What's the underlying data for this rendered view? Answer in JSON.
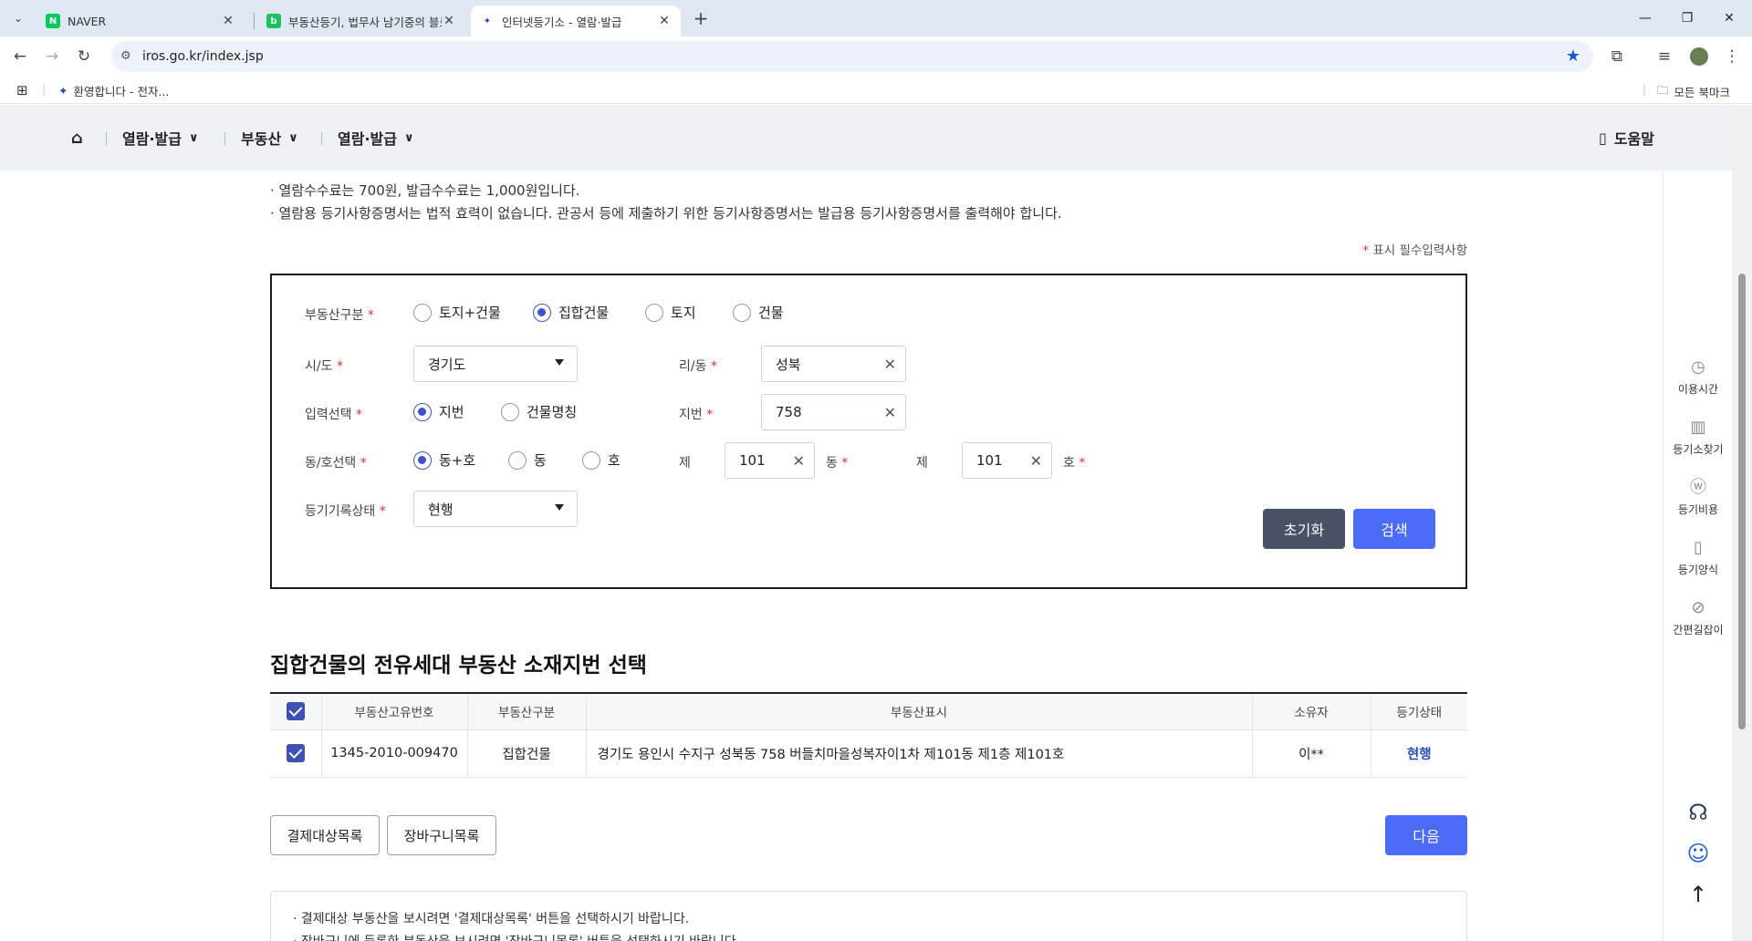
{
  "browser": {
    "tabs": [
      {
        "title": "NAVER",
        "favicon": "naver-favicon"
      },
      {
        "title": "부동산등기, 법무사 남기중의 블로그",
        "favicon": "blog-favicon"
      },
      {
        "title": "인터넷등기소 - 열람·발급",
        "favicon": "iros-favicon"
      }
    ],
    "new_tab": "+",
    "url": "iros.go.kr/index.jsp",
    "bookmark_item": "환영합니다 - 전자...",
    "all_bookmarks": "모든 북마크"
  },
  "site_nav": {
    "items": [
      "열람·발급",
      "부동산",
      "열람·발급"
    ],
    "help": "도움말"
  },
  "notices": [
    "· 열람수수료는 700원, 발급수수료는 1,000원입니다.",
    "· 열람용 등기사항증명서는 법적 효력이 없습니다. 관공서 등에 제출하기 위한 등기사항증명서는 발급용 등기사항증명서를 출력해야 합니다."
  ],
  "required_note": {
    "star": "*",
    "text": "표시 필수입력사항"
  },
  "form": {
    "property_type": {
      "label": "부동산구분",
      "options": [
        "토지+건물",
        "집합건물",
        "토지",
        "건물"
      ],
      "selected": "집합건물"
    },
    "sido": {
      "label": "시/도",
      "value": "경기도"
    },
    "ri_dong": {
      "label": "리/동",
      "value": "성북"
    },
    "input_select": {
      "label": "입력선택",
      "options": [
        "지번",
        "건물명칭"
      ],
      "selected": "지번"
    },
    "jibun": {
      "label": "지번",
      "value": "758"
    },
    "dong_ho_select": {
      "label": "동/호선택",
      "options": [
        "동+호",
        "동",
        "호"
      ],
      "selected": "동+호"
    },
    "dong": {
      "prefix": "제",
      "value": "101",
      "suffix": "동"
    },
    "ho": {
      "prefix": "제",
      "value": "101",
      "suffix": "호"
    },
    "record_status": {
      "label": "등기기록상태",
      "value": "현행"
    },
    "reset_button": "초기화",
    "search_button": "검색"
  },
  "section_title": "집합건물의 전유세대 부동산 소재지번 선택",
  "table": {
    "headers": [
      "부동산고유번호",
      "부동산구분",
      "부동산표시",
      "소유자",
      "등기상태"
    ],
    "rows": [
      {
        "id": "1345-2010-009470",
        "type": "집합건물",
        "address": "경기도 용인시 수지구 성북동 758 버들치마을성복자이1차 제101동 제1층 제101호",
        "owner": "이**",
        "status": "현행",
        "checked": true
      }
    ],
    "header_checked": true
  },
  "actions": {
    "payment_list": "결제대상목록",
    "cart_list": "장바구니목록",
    "next": "다음"
  },
  "info_lines": [
    "· 결제대상 부동산을 보시려면 '결제대상목록' 버튼을 선택하시기 바랍니다.",
    "· 장바구니에 등록한 부동산을 보시려면 '장바구니목록' 버튼을 선택하시기 바랍니다."
  ],
  "rail": [
    "이용시간",
    "등기소찾기",
    "등기비용",
    "등기양식",
    "간편길잡이"
  ],
  "colors": {
    "accent_blue": "#4a6cf7",
    "dark_button": "#4a5164",
    "required_red": "#e03131",
    "status_link": "#1f4fb7"
  }
}
